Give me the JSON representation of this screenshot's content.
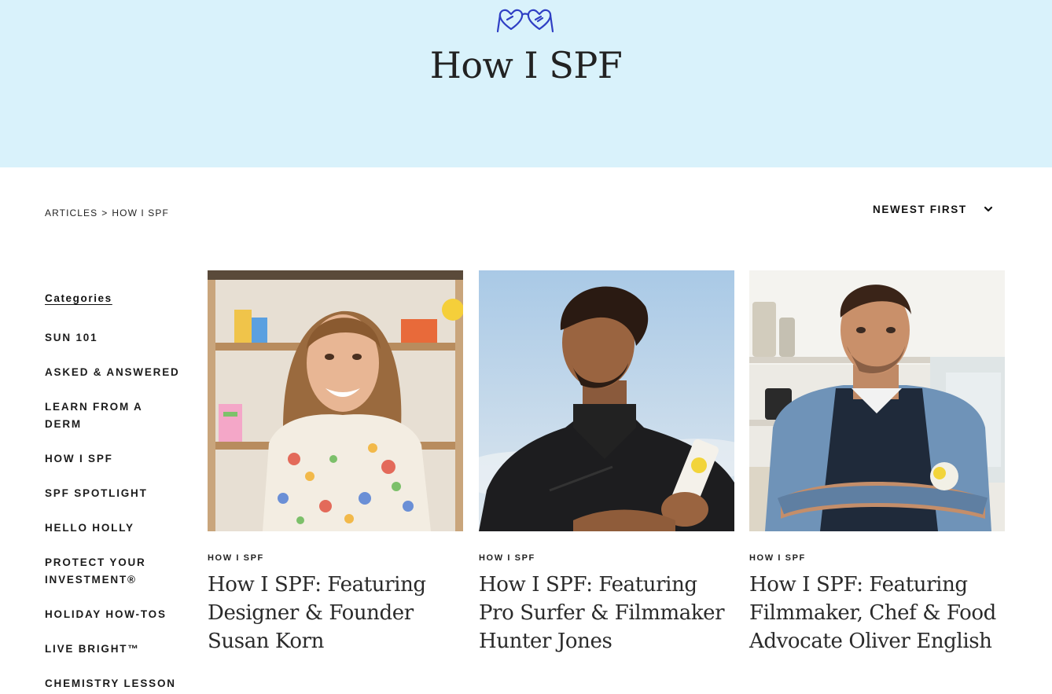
{
  "hero": {
    "title": "How I SPF",
    "logo_icon": "heart-sunglasses-icon",
    "background": "#d9f2fb"
  },
  "breadcrumb": {
    "root": "ARTICLES",
    "separator": ">",
    "current": "HOW I SPF"
  },
  "sort": {
    "label": "NEWEST FIRST",
    "icon": "chevron-down-icon"
  },
  "sidebar": {
    "heading": "Categories",
    "items": [
      {
        "label": "SUN 101"
      },
      {
        "label": "ASKED & ANSWERED"
      },
      {
        "label": "LEARN FROM A DERM"
      },
      {
        "label": "HOW I SPF",
        "active": true
      },
      {
        "label": "SPF SPOTLIGHT"
      },
      {
        "label": "HELLO HOLLY"
      },
      {
        "label": "PROTECT YOUR INVESTMENT®"
      },
      {
        "label": "HOLIDAY HOW-TOS"
      },
      {
        "label": "LIVE BRIGHT™"
      },
      {
        "label": "CHEMISTRY LESSON"
      }
    ],
    "highlight_color": "#f9ef2a"
  },
  "articles": [
    {
      "tag": "HOW I SPF",
      "title": "How I SPF: Featuring Designer & Founder Susan Korn"
    },
    {
      "tag": "HOW I SPF",
      "title": "How I SPF: Featuring Pro Surfer & Filmmaker Hunter Jones"
    },
    {
      "tag": "HOW I SPF",
      "title": "How I SPF: Featuring Filmmaker, Chef & Food Advocate Oliver English"
    }
  ]
}
